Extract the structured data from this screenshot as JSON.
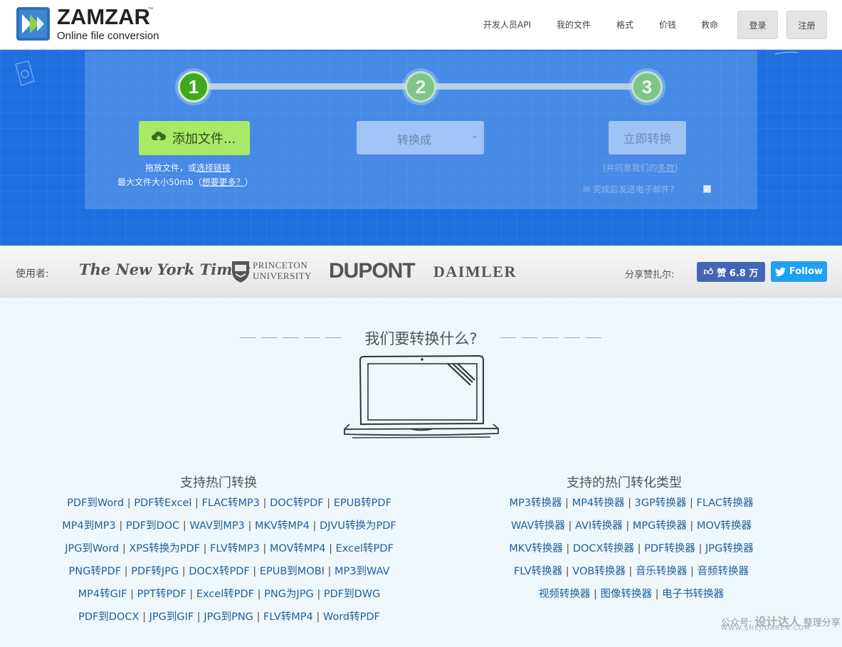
{
  "header": {
    "brand": "ZAMZAR",
    "trademark": "™",
    "tagline": "Online file conversion",
    "nav": [
      "开发人员API",
      "我的文件",
      "格式",
      "价钱",
      "救命"
    ],
    "login": "登录",
    "signup": "注册"
  },
  "hero": {
    "steps": [
      "1",
      "2",
      "3"
    ],
    "add_files": "添加文件...",
    "drop_text": "拖放文件，或",
    "select_link": "选择链接",
    "max_size": "最大文件大小50mb（",
    "want_more": "想要更多？",
    "max_size_end": "）",
    "convert_to": "转换成",
    "convert_now": "立即转换",
    "terms_pre": "(并同意我们的",
    "terms_link": "条款",
    "terms_post": ")",
    "email_notify": "完成后发送电子邮件?"
  },
  "partners": {
    "used_by": "使用者:",
    "logos": [
      "The New York Times",
      "PRINCETON",
      "UNIVERSITY",
      "DUPONT",
      "DAIMLER"
    ],
    "share_label": "分享赞扎尔:",
    "like_label": "赞 6.8 万",
    "follow_label": "Follow"
  },
  "main": {
    "title": "我们要转换什么?",
    "left_title": "支持热门转换",
    "right_title": "支持的热门转化类型",
    "left_rows": [
      [
        "PDF到Word",
        "PDF转Excel",
        "FLAC转MP3",
        "DOC转PDF",
        "EPUB转PDF"
      ],
      [
        "MP4到MP3",
        "PDF到DOC",
        "WAV到MP3",
        "MKV转MP4",
        "DJVU转换为PDF"
      ],
      [
        "JPG到Word",
        "XPS转换为PDF",
        "FLV转MP3",
        "MOV转MP4",
        "Excel转PDF"
      ],
      [
        "PNG转PDF",
        "PDF转JPG",
        "DOCX转PDF",
        "EPUB到MOBI",
        "MP3到WAV"
      ],
      [
        "MP4转GIF",
        "PPT转PDF",
        "Excel转PDF",
        "PNG为JPG",
        "PDF到DWG"
      ],
      [
        "PDF到DOCX",
        "JPG到GIF",
        "JPG到PNG",
        "FLV转MP4",
        "Word转PDF"
      ]
    ],
    "right_rows": [
      [
        "MP3转换器",
        "MP4转换器",
        "3GP转换器",
        "FLAC转换器"
      ],
      [
        "WAV转换器",
        "AVI转换器",
        "MPG转换器",
        "MOV转换器"
      ],
      [
        "MKV转换器",
        "DOCX转换器",
        "PDF转换器",
        "JPG转换器"
      ],
      [
        "FLV转换器",
        "VOB转换器",
        "音乐转换器",
        "音频转换器"
      ],
      [
        "视频转换器",
        "图像转换器",
        "电子书转换器"
      ]
    ]
  },
  "watermark": {
    "line1_pre": "公众号:",
    "line1_brand": "设计达人",
    "line1_post": "整理分享",
    "line2": "WWW.SHEJIDAREN.COM"
  },
  "colors": {
    "hero_blue": "#1f6fe0",
    "accent_green": "#3fa91e",
    "add_button_green": "#a8ea66",
    "link_blue": "#1f5f9c",
    "facebook": "#4267b2",
    "twitter": "#1da1f2"
  }
}
